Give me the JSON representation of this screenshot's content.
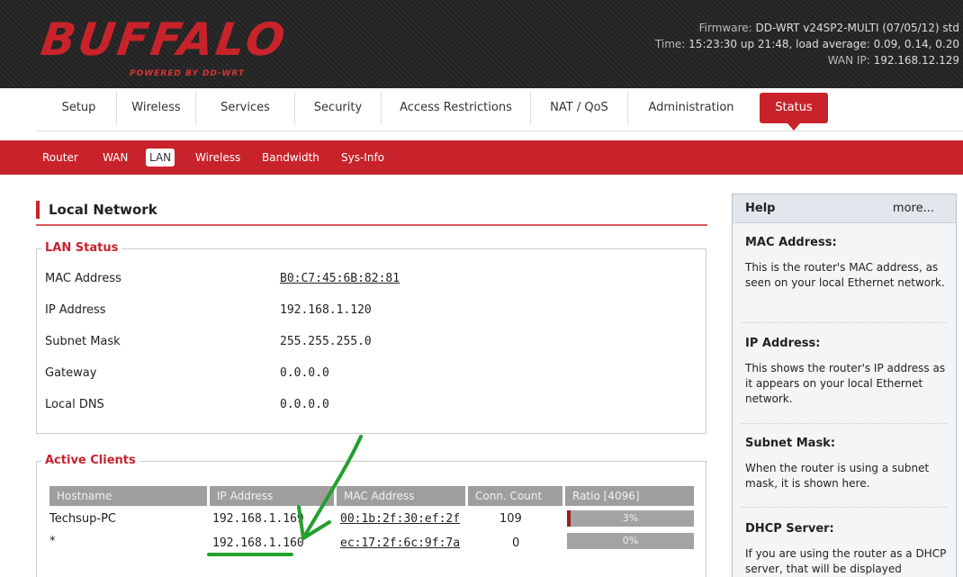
{
  "brand": {
    "logo": "BUFFALO",
    "tagline": "POWERED BY DD-WRT"
  },
  "firmware": {
    "firmware_label": "Firmware:",
    "firmware_value": "DD-WRT v24SP2-MULTI (07/05/12) std",
    "time_label": "Time:",
    "time_value": "15:23:30 up 21:48, load average: 0.09, 0.14, 0.20",
    "wan_label": "WAN IP:",
    "wan_value": "192.168.12.129"
  },
  "nav": {
    "tabs": [
      "Setup",
      "Wireless",
      "Services",
      "Security",
      "Access Restrictions",
      "NAT / QoS",
      "Administration",
      "Status"
    ],
    "active": "Status"
  },
  "subnav": {
    "items": [
      "Router",
      "WAN",
      "LAN",
      "Wireless",
      "Bandwidth",
      "Sys-Info"
    ],
    "active": "LAN"
  },
  "page_title": "Local Network",
  "lan_status": {
    "legend": "LAN Status",
    "rows": [
      {
        "label": "MAC Address",
        "value": "B0:C7:45:6B:82:81"
      },
      {
        "label": "IP Address",
        "value": "192.168.1.120"
      },
      {
        "label": "Subnet Mask",
        "value": "255.255.255.0"
      },
      {
        "label": "Gateway",
        "value": "0.0.0.0"
      },
      {
        "label": "Local DNS",
        "value": "0.0.0.0"
      }
    ]
  },
  "active_clients": {
    "legend": "Active Clients",
    "headers": [
      "Hostname",
      "IP Address",
      "MAC Address",
      "Conn. Count",
      "Ratio [4096]"
    ],
    "rows": [
      {
        "hostname": "Techsup-PC",
        "ip": "192.168.1.169",
        "mac": "00:1b:2f:30:ef:2f",
        "count": "109",
        "ratio": "3%",
        "ratio_value": 3
      },
      {
        "hostname": "*",
        "ip": "192.168.1.160",
        "mac": "ec:17:2f:6c:9f:7a",
        "count": "0",
        "ratio": "0%",
        "ratio_value": 0
      }
    ]
  },
  "help": {
    "title": "Help",
    "more": "more...",
    "sections": [
      {
        "heading": "MAC Address:",
        "text": "This is the router's MAC address, as seen on your local Ethernet network."
      },
      {
        "heading": "IP Address:",
        "text": "This shows the router's IP address as it appears on your local Ethernet network."
      },
      {
        "heading": "Subnet Mask:",
        "text": "When the router is using a subnet mask, it is shown here."
      },
      {
        "heading": "DHCP Server:",
        "text": "If you are using the router as a DHCP server, that will be displayed"
      }
    ]
  },
  "colors": {
    "brand_red": "#c8232b",
    "header_bg": "#262626",
    "annotation_green": "#23a02d"
  }
}
